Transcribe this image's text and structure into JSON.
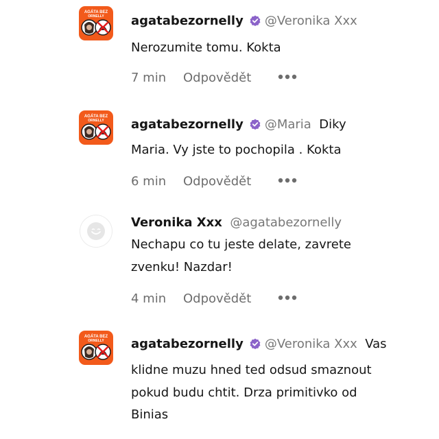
{
  "comments": [
    {
      "username": "agatabezornelly",
      "verified": true,
      "avatar": "orange-logo",
      "mention": "@Veronika Xxx",
      "lines": [
        "Nerozumite tomu. Kokta"
      ],
      "time": "7 min",
      "reply": "Odpovědět",
      "more_icon": "more-icon"
    },
    {
      "username": "agatabezornelly",
      "verified": true,
      "avatar": "orange-logo",
      "mention": "@Maria",
      "lines": [
        "Diky",
        "Maria. Vy jste to pochopila . Kokta"
      ],
      "time": "6 min",
      "reply": "Odpovědět",
      "more_icon": "more-icon"
    },
    {
      "username": "Veronika Xxx",
      "verified": false,
      "avatar": "default-avatar",
      "mention": "@agatabezornelly",
      "lines": [
        "Nechapu co tu jeste delate, zavrete",
        "zvenku! Nazdar!"
      ],
      "time": "4 min",
      "reply": "Odpovědět",
      "more_icon": "more-icon"
    },
    {
      "username": "agatabezornelly",
      "verified": true,
      "avatar": "orange-logo",
      "mention": "@Veronika Xxx",
      "lines": [
        "Vas",
        "klidne muzu hned ted odsud smaznout",
        "pokud budu chtit. Drza primitivko od",
        "Binias"
      ]
    }
  ],
  "avatar_logo_text": [
    "AGÁTA BEZ",
    "ORNELLY"
  ],
  "colors": {
    "brand_orange": "#f25a1b",
    "verified_purple": "#8b63c9",
    "mention_gray": "#777777",
    "meta_gray": "#6d6d6d"
  }
}
